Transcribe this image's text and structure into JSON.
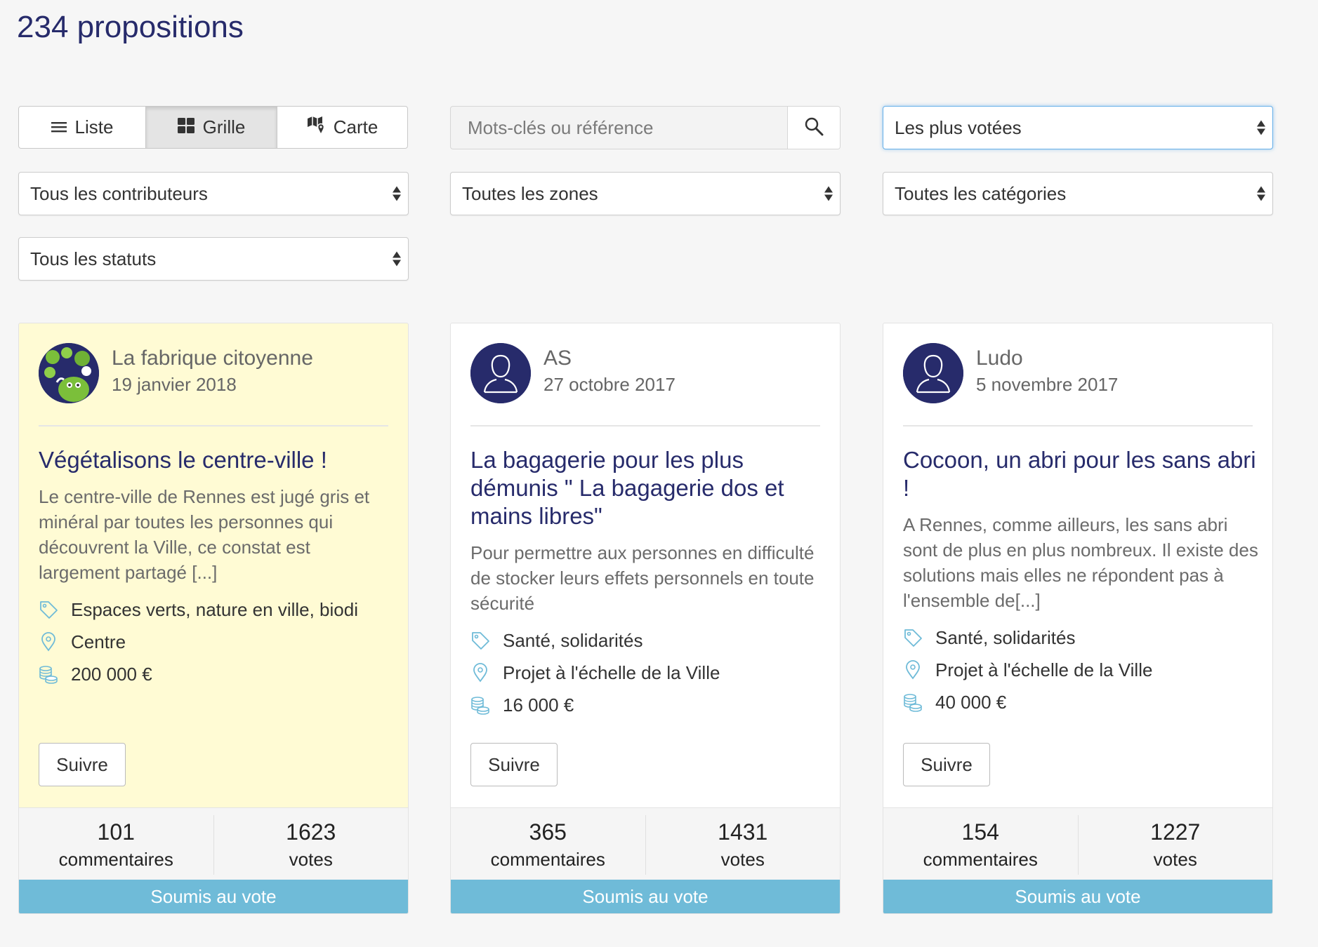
{
  "page": {
    "title": "234 propositions"
  },
  "views": [
    {
      "label": "Liste",
      "icon": "list-icon"
    },
    {
      "label": "Grille",
      "icon": "grid-icon",
      "active": true
    },
    {
      "label": "Carte",
      "icon": "map-icon"
    }
  ],
  "search": {
    "placeholder": "Mots-clés ou référence",
    "value": ""
  },
  "filters": {
    "sort": "Les plus votées",
    "contributors": "Tous les contributeurs",
    "zones": "Toutes les zones",
    "categories": "Toutes les catégories",
    "statuses": "Tous les statuts"
  },
  "colors": {
    "primary": "#272b6b",
    "status_bar": "#6fbbd8",
    "highlight": "#fffbd4",
    "icon_accent": "#6fbbd8"
  },
  "cards": [
    {
      "author": "La fabrique citoyenne",
      "date": "19 janvier 2018",
      "title": "Végétalisons le centre-ville !",
      "excerpt": " Le centre-ville de Rennes est jugé gris et minéral par toutes les personnes qui découvrent la Ville, ce constat est largement partagé [...]",
      "category": "Espaces verts, nature en ville, biodi",
      "zone": "Centre",
      "budget": "200 000 €",
      "follow_label": "Suivre",
      "comments": "101",
      "comments_label": "commentaires",
      "votes": "1623",
      "votes_label": "votes",
      "status": "Soumis au vote"
    },
    {
      "author": "AS",
      "date": "27 octobre 2017",
      "title": "La bagagerie pour les plus démunis \" La bagagerie dos et mains libres\"",
      "excerpt": "Pour permettre aux personnes en difficulté de stocker leurs effets personnels en toute sécurité",
      "category": "Santé, solidarités",
      "zone": "Projet à l'échelle de la Ville",
      "budget": "16 000 €",
      "follow_label": "Suivre",
      "comments": "365",
      "comments_label": "commentaires",
      "votes": "1431",
      "votes_label": "votes",
      "status": "Soumis au vote"
    },
    {
      "author": "Ludo",
      "date": "5 novembre 2017",
      "title": "Cocoon, un abri pour les sans abri !",
      "excerpt": "A Rennes, comme ailleurs, les sans abri sont de plus en plus nombreux. Il existe des solutions mais elles ne répondent pas à l'ensemble de[...]",
      "category": "Santé, solidarités",
      "zone": "Projet à l'échelle de la Ville",
      "budget": "40 000 €",
      "follow_label": "Suivre",
      "comments": "154",
      "comments_label": "commentaires",
      "votes": "1227",
      "votes_label": "votes",
      "status": "Soumis au vote"
    }
  ]
}
